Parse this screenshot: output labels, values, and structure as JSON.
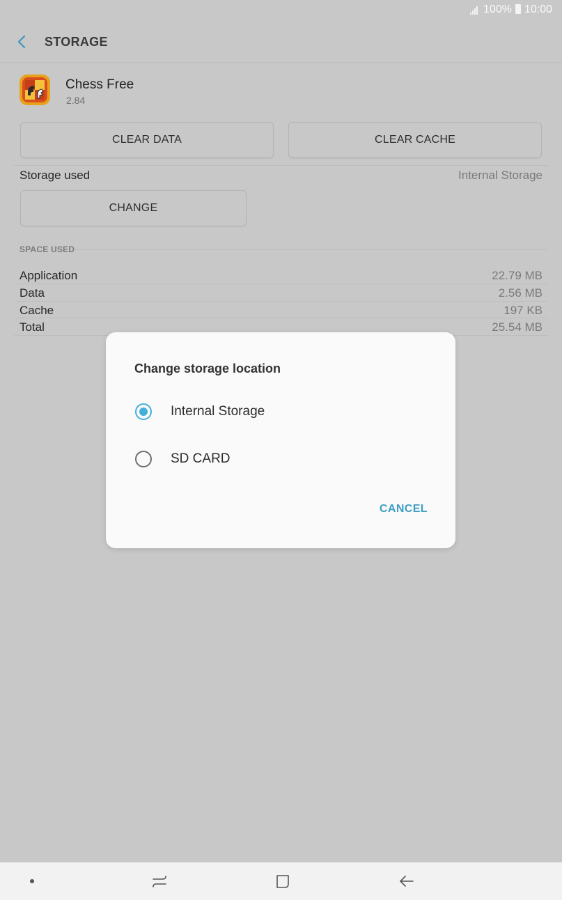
{
  "status_bar": {
    "battery": "100%",
    "time": "10:00",
    "icons": [
      "signal-icon",
      "battery-icon"
    ]
  },
  "header": {
    "title": "STORAGE",
    "back_icon": "chevron-left-icon"
  },
  "app": {
    "name": "Chess Free",
    "version": "2.84",
    "icon": "chess-app-icon"
  },
  "buttons": {
    "clear_data": "CLEAR DATA",
    "clear_cache": "CLEAR CACHE",
    "change": "CHANGE"
  },
  "storage_used": {
    "label": "Storage used",
    "value": "Internal Storage"
  },
  "space_used": {
    "header": "SPACE USED",
    "rows": [
      {
        "label": "Application",
        "value": "22.79 MB"
      },
      {
        "label": "Data",
        "value": "2.56 MB"
      },
      {
        "label": "Cache",
        "value": "197 KB"
      },
      {
        "label": "Total",
        "value": "25.54 MB"
      }
    ]
  },
  "dialog": {
    "title": "Change storage location",
    "options": [
      {
        "label": "Internal Storage",
        "selected": true
      },
      {
        "label": "SD CARD",
        "selected": false
      }
    ],
    "cancel": "CANCEL"
  },
  "nav_bar": {
    "icons": [
      "dot-icon",
      "recent-apps-icon",
      "home-icon",
      "back-arrow-icon"
    ]
  },
  "colors": {
    "accent": "#43b0d8",
    "dim_background": "#c8c8c8",
    "dialog_background": "#fafafa",
    "cancel_text": "#3d9dc4"
  }
}
